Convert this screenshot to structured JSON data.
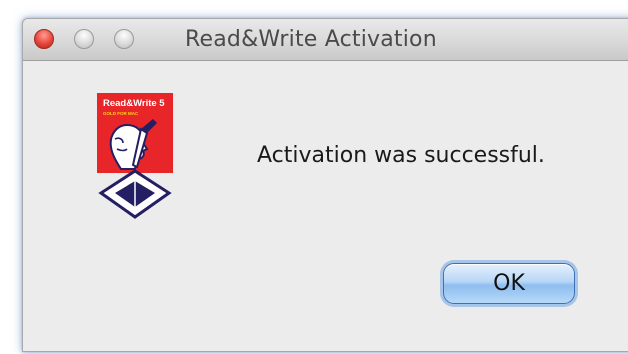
{
  "window": {
    "title": "Read&Write Activation"
  },
  "logo": {
    "name": "Read&Write 5",
    "subtitle": "GOLD FOR MAC"
  },
  "dialog": {
    "message": "Activation was successful.",
    "ok_label": "OK"
  },
  "colors": {
    "logo_red": "#e8262a",
    "logo_navy": "#241f63",
    "close_red": "#e8453a",
    "button_blue": "#8fbdef"
  }
}
